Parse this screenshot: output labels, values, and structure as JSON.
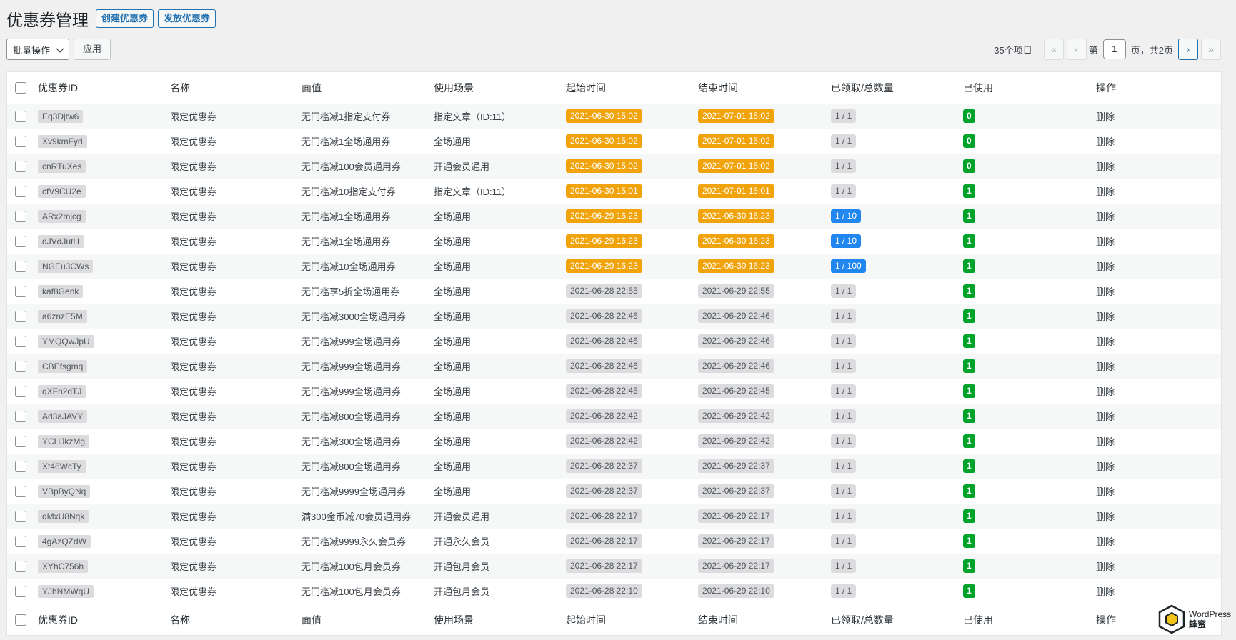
{
  "header": {
    "title": "优惠券管理",
    "create_btn": "创建优惠券",
    "issue_btn": "发放优惠券"
  },
  "toolbar": {
    "bulk_action": "批量操作",
    "apply": "应用",
    "items_count": "35个项目",
    "first": "«",
    "prev": "‹",
    "next": "›",
    "last": "»",
    "page_prefix": "第",
    "current_page": "1",
    "page_suffix": "页，共2页"
  },
  "columns": [
    "优惠券ID",
    "名称",
    "面值",
    "使用场景",
    "起始时间",
    "结束时间",
    "已领取/总数量",
    "已使用",
    "操作"
  ],
  "colors": {
    "orange": "#f0a30a",
    "blue": "#2186ef",
    "green": "#00a32a",
    "gray": "#dcdcde"
  },
  "rows": [
    {
      "id": "Eq3Djtw6",
      "name": "限定优惠券",
      "value": "无门槛减1指定支付券",
      "scene": "指定文章（ID:11）",
      "start": "2021-06-30 15:02",
      "end": "2021-07-01 15:02",
      "time_style": "orange",
      "claimed": "1 / 1",
      "claim_style": "gray",
      "used": "0",
      "action": "删除"
    },
    {
      "id": "Xv9kmFyd",
      "name": "限定优惠券",
      "value": "无门槛减1全场通用券",
      "scene": "全场通用",
      "start": "2021-06-30 15:02",
      "end": "2021-07-01 15:02",
      "time_style": "orange",
      "claimed": "1 / 1",
      "claim_style": "gray",
      "used": "0",
      "action": "删除"
    },
    {
      "id": "cnRTuXes",
      "name": "限定优惠券",
      "value": "无门槛减100会员通用券",
      "scene": "开通会员通用",
      "start": "2021-06-30 15:02",
      "end": "2021-07-01 15:02",
      "time_style": "orange",
      "claimed": "1 / 1",
      "claim_style": "gray",
      "used": "0",
      "action": "删除"
    },
    {
      "id": "cfV9CU2e",
      "name": "限定优惠券",
      "value": "无门槛减10指定支付券",
      "scene": "指定文章（ID:11）",
      "start": "2021-06-30 15:01",
      "end": "2021-07-01 15:01",
      "time_style": "orange",
      "claimed": "1 / 1",
      "claim_style": "gray",
      "used": "1",
      "action": "删除"
    },
    {
      "id": "ARx2mjcg",
      "name": "限定优惠券",
      "value": "无门槛减1全场通用券",
      "scene": "全场通用",
      "start": "2021-06-29 16:23",
      "end": "2021-06-30 16:23",
      "time_style": "orange",
      "claimed": "1 / 10",
      "claim_style": "blue",
      "used": "1",
      "action": "删除"
    },
    {
      "id": "dJVdJutH",
      "name": "限定优惠券",
      "value": "无门槛减1全场通用券",
      "scene": "全场通用",
      "start": "2021-06-29 16:23",
      "end": "2021-06-30 16:23",
      "time_style": "orange",
      "claimed": "1 / 10",
      "claim_style": "blue",
      "used": "1",
      "action": "删除"
    },
    {
      "id": "NGEu3CWs",
      "name": "限定优惠券",
      "value": "无门槛减10全场通用券",
      "scene": "全场通用",
      "start": "2021-06-29 16:23",
      "end": "2021-06-30 16:23",
      "time_style": "orange",
      "claimed": "1 / 100",
      "claim_style": "blue",
      "used": "1",
      "action": "删除"
    },
    {
      "id": "kaf8Genk",
      "name": "限定优惠券",
      "value": "无门槛享5折全场通用券",
      "scene": "全场通用",
      "start": "2021-06-28 22:55",
      "end": "2021-06-29 22:55",
      "time_style": "gray",
      "claimed": "1 / 1",
      "claim_style": "gray",
      "used": "1",
      "action": "删除"
    },
    {
      "id": "a6znzE5M",
      "name": "限定优惠券",
      "value": "无门槛减3000全场通用券",
      "scene": "全场通用",
      "start": "2021-06-28 22:46",
      "end": "2021-06-29 22:46",
      "time_style": "gray",
      "claimed": "1 / 1",
      "claim_style": "gray",
      "used": "1",
      "action": "删除"
    },
    {
      "id": "YMQQwJpU",
      "name": "限定优惠券",
      "value": "无门槛减999全场通用券",
      "scene": "全场通用",
      "start": "2021-06-28 22:46",
      "end": "2021-06-29 22:46",
      "time_style": "gray",
      "claimed": "1 / 1",
      "claim_style": "gray",
      "used": "1",
      "action": "删除"
    },
    {
      "id": "CBEfsgmq",
      "name": "限定优惠券",
      "value": "无门槛减999全场通用券",
      "scene": "全场通用",
      "start": "2021-06-28 22:46",
      "end": "2021-06-29 22:46",
      "time_style": "gray",
      "claimed": "1 / 1",
      "claim_style": "gray",
      "used": "1",
      "action": "删除"
    },
    {
      "id": "qXFn2dTJ",
      "name": "限定优惠券",
      "value": "无门槛减999全场通用券",
      "scene": "全场通用",
      "start": "2021-06-28 22:45",
      "end": "2021-06-29 22:45",
      "time_style": "gray",
      "claimed": "1 / 1",
      "claim_style": "gray",
      "used": "1",
      "action": "删除"
    },
    {
      "id": "Ad3aJAVY",
      "name": "限定优惠券",
      "value": "无门槛减800全场通用券",
      "scene": "全场通用",
      "start": "2021-06-28 22:42",
      "end": "2021-06-29 22:42",
      "time_style": "gray",
      "claimed": "1 / 1",
      "claim_style": "gray",
      "used": "1",
      "action": "删除"
    },
    {
      "id": "YCHJkzMg",
      "name": "限定优惠券",
      "value": "无门槛减300全场通用券",
      "scene": "全场通用",
      "start": "2021-06-28 22:42",
      "end": "2021-06-29 22:42",
      "time_style": "gray",
      "claimed": "1 / 1",
      "claim_style": "gray",
      "used": "1",
      "action": "删除"
    },
    {
      "id": "Xt46WcTy",
      "name": "限定优惠券",
      "value": "无门槛减800全场通用券",
      "scene": "全场通用",
      "start": "2021-06-28 22:37",
      "end": "2021-06-29 22:37",
      "time_style": "gray",
      "claimed": "1 / 1",
      "claim_style": "gray",
      "used": "1",
      "action": "删除"
    },
    {
      "id": "VBpByQNq",
      "name": "限定优惠券",
      "value": "无门槛减9999全场通用券",
      "scene": "全场通用",
      "start": "2021-06-28 22:37",
      "end": "2021-06-29 22:37",
      "time_style": "gray",
      "claimed": "1 / 1",
      "claim_style": "gray",
      "used": "1",
      "action": "删除"
    },
    {
      "id": "qMxU8Nqk",
      "name": "限定优惠券",
      "value": "满300金币减70会员通用券",
      "scene": "开通会员通用",
      "start": "2021-06-28 22:17",
      "end": "2021-06-29 22:17",
      "time_style": "gray",
      "claimed": "1 / 1",
      "claim_style": "gray",
      "used": "1",
      "action": "删除"
    },
    {
      "id": "4gAzQZdW",
      "name": "限定优惠券",
      "value": "无门槛减9999永久会员券",
      "scene": "开通永久会员",
      "start": "2021-06-28 22:17",
      "end": "2021-06-29 22:17",
      "time_style": "gray",
      "claimed": "1 / 1",
      "claim_style": "gray",
      "used": "1",
      "action": "删除"
    },
    {
      "id": "XYhC756h",
      "name": "限定优惠券",
      "value": "无门槛减100包月会员券",
      "scene": "开通包月会员",
      "start": "2021-06-28 22:17",
      "end": "2021-06-29 22:17",
      "time_style": "gray",
      "claimed": "1 / 1",
      "claim_style": "gray",
      "used": "1",
      "action": "删除"
    },
    {
      "id": "YJhNMWqU",
      "name": "限定优惠券",
      "value": "无门槛减100包月会员券",
      "scene": "开通包月会员",
      "start": "2021-06-28 22:10",
      "end": "2021-06-29 22:10",
      "time_style": "gray",
      "claimed": "1 / 1",
      "claim_style": "gray",
      "used": "1",
      "action": "删除"
    }
  ],
  "brand": {
    "line1": "WordPress",
    "line2": "蜂蜜",
    "icon": "hexagon-logo-icon"
  }
}
